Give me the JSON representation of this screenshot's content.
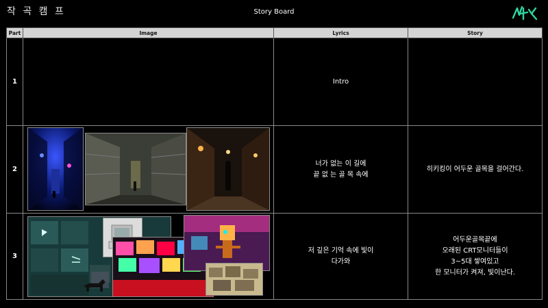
{
  "header": {
    "left_title": "작 곡 캠 프",
    "center_title": "Story Board"
  },
  "colors": {
    "logo": "#2fd6a0",
    "header_bg": "#d4d4d4",
    "cell_border": "#8a8a8a"
  },
  "table": {
    "columns": [
      "Part",
      "Image",
      "Lyrics",
      "Story"
    ],
    "rows": [
      {
        "part": "1",
        "lyrics": "Intro",
        "story": ""
      },
      {
        "part": "2",
        "lyrics": "너가 없는 이 길에\n끝 없 는 골 목 속에",
        "story": "히키킹이 어두운 골목을 걸어간다."
      },
      {
        "part": "3",
        "lyrics": "저 깊은 기억 속에 빛이\n다가와",
        "story": "어두운골목끝에\n오래된 CRT모니터들이\n3~5대 쌓여있고\n한 모니터가 켜져, 빛이난다."
      }
    ]
  }
}
